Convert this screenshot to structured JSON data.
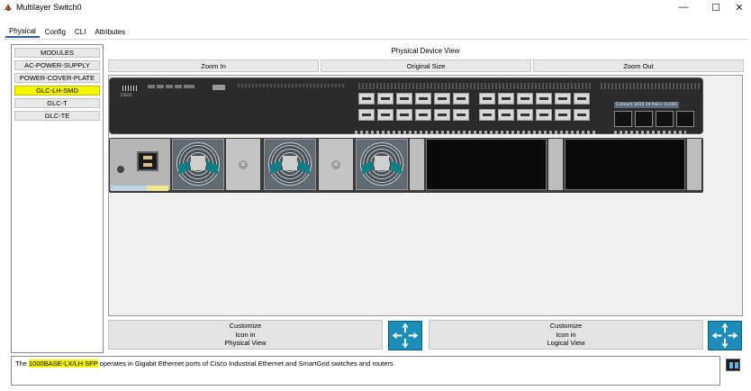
{
  "window": {
    "title": "Multilayer Switch0",
    "minimize": "—",
    "maximize": "☐",
    "close": "✕"
  },
  "tabs": [
    "Physical",
    "Config",
    "CLI",
    "Attributes"
  ],
  "modules": {
    "header": "MODULES",
    "items": [
      "AC-POWER-SUPPLY",
      "POWER-COVER-PLATE",
      "GLC-LH-SMD",
      "GLC-T",
      "GLC-TE"
    ],
    "selected": "GLC-LH-SMD"
  },
  "view": {
    "title": "Physical Device View",
    "zoom_in": "Zoom In",
    "original_size": "Original Size",
    "zoom_out": "Zoom Out",
    "model_label": "Catalyst 3650 24 PoE+ 2x10G",
    "brand": "CISCO"
  },
  "customize": {
    "physical": [
      "Customize",
      "Icon in",
      "Physical View"
    ],
    "logical": [
      "Customize",
      "Icon in",
      "Logical View"
    ]
  },
  "info": {
    "prefix": "The ",
    "highlight": "1000BASE-LX/LH SFP",
    "suffix": " operates in Gigabit Ethernet ports of Cisco Industrial Ethernet and SmartGrid switches and routers"
  },
  "colors": {
    "selected": "#f5f500",
    "switch_icon": "#1b8db8"
  }
}
